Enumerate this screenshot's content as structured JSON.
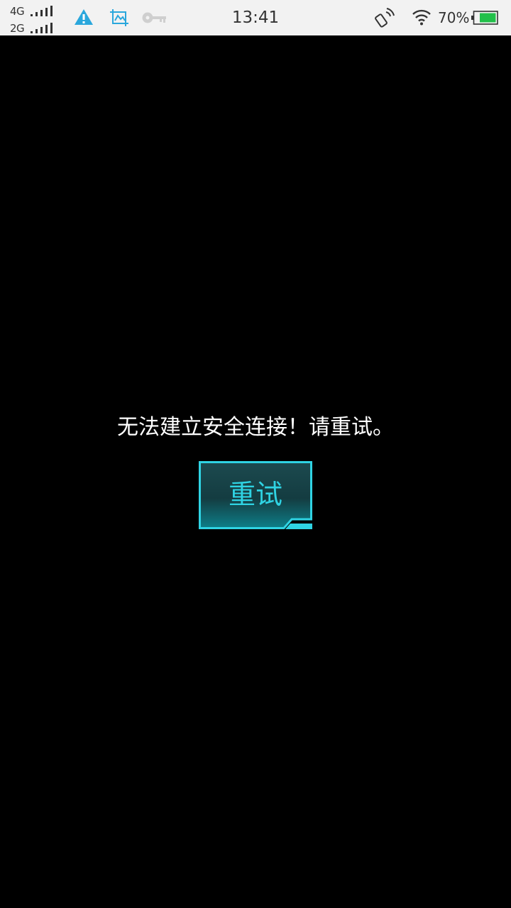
{
  "status_bar": {
    "network_1": "4G",
    "network_2": "2G",
    "time": "13:41",
    "battery_percent": "70%",
    "icons": [
      "signal-icon",
      "warning-icon",
      "screenshot-icon",
      "vpn-key-icon",
      "nfc-icon",
      "wifi-icon",
      "battery-icon"
    ],
    "colors": {
      "background": "#f2f2f2",
      "warning": "#2aa7dc",
      "battery_fill": "#22c04a"
    }
  },
  "main": {
    "error_message": "无法建立安全连接！请重试。",
    "retry_label": "重试",
    "colors": {
      "background": "#000000",
      "accent": "#2fd3e3"
    }
  }
}
